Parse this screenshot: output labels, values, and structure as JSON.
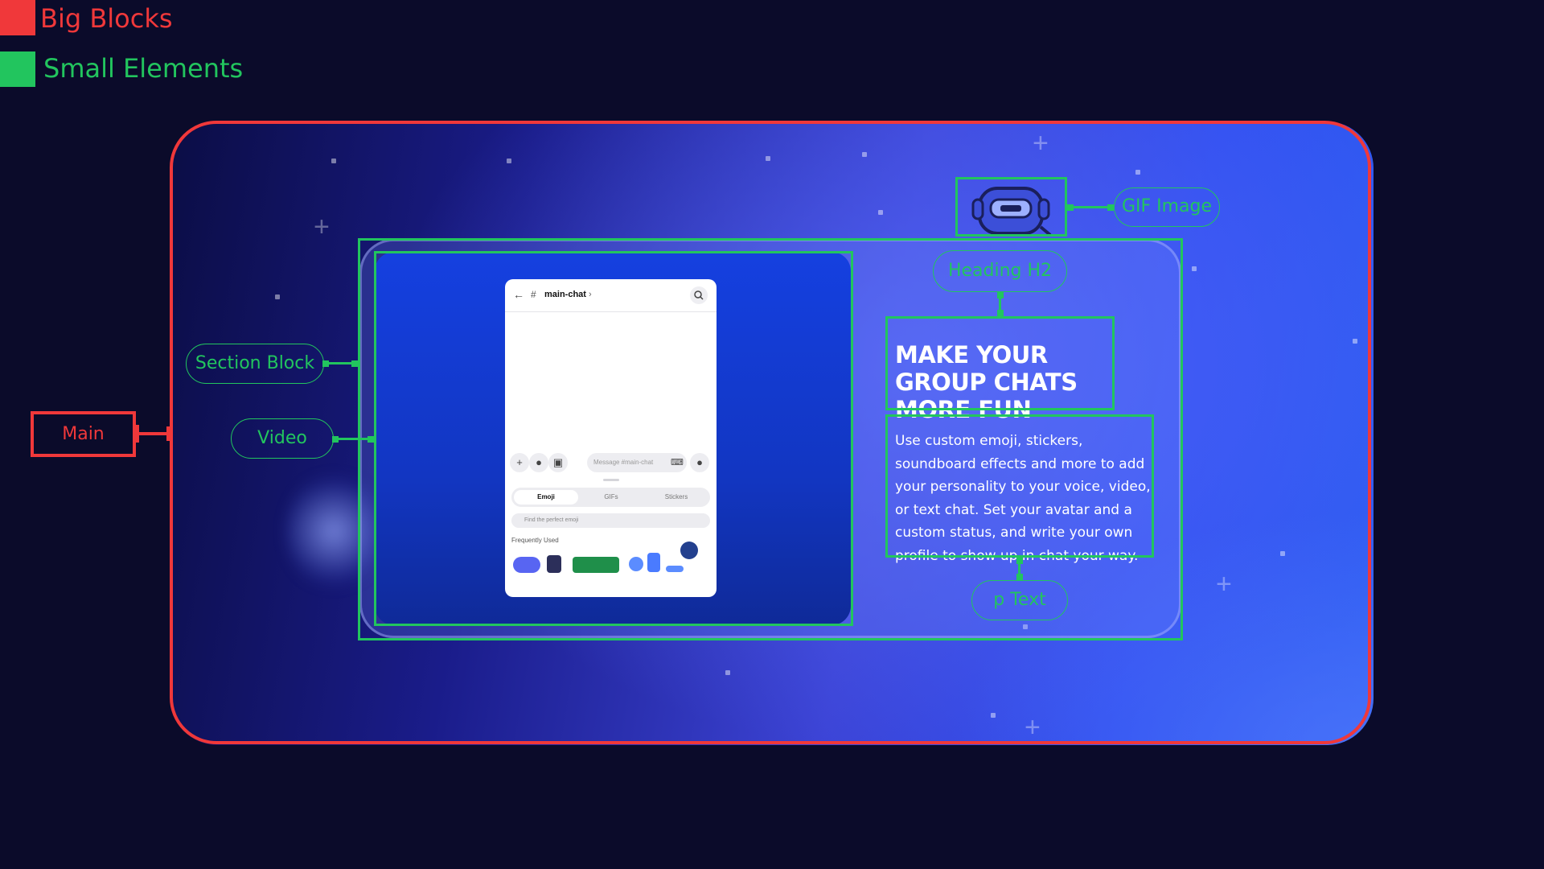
{
  "legend": {
    "big_blocks": "Big Blocks",
    "big_blocks_color": "#f0383a",
    "small_elements": "Small Elements",
    "small_elements_color": "#22c55e"
  },
  "annotations": {
    "main": "Main",
    "section_block": "Section Block",
    "video": "Video",
    "gif_image": "GIF Image",
    "heading_h2": "Heading H2",
    "p_text": "p Text"
  },
  "hero": {
    "heading": "MAKE YOUR GROUP CHATS MORE FUN",
    "paragraph": "Use custom emoji, stickers, soundboard effects and more to add your personality to your voice, video, or text chat. Set your avatar and a custom status, and write your own profile to show up in chat your way.",
    "gif_icon": "robot-mascot-icon"
  },
  "phone": {
    "back_icon": "arrow-left-icon",
    "channel_prefix": "#",
    "channel_name": "main-chat",
    "channel_chevron": "›",
    "search_icon": "search-icon",
    "toolbar_icons": [
      "plus-icon",
      "apps-icon",
      "gift-icon"
    ],
    "message_placeholder": "Message #main-chat",
    "keyboard_icon": "keyboard-icon",
    "mic_icon": "mic-icon",
    "tabs": [
      "Emoji",
      "GIFs",
      "Stickers"
    ],
    "active_tab": "Emoji",
    "search_placeholder": "Find the perfect emoji",
    "frequently_used_label": "Frequently Used"
  }
}
